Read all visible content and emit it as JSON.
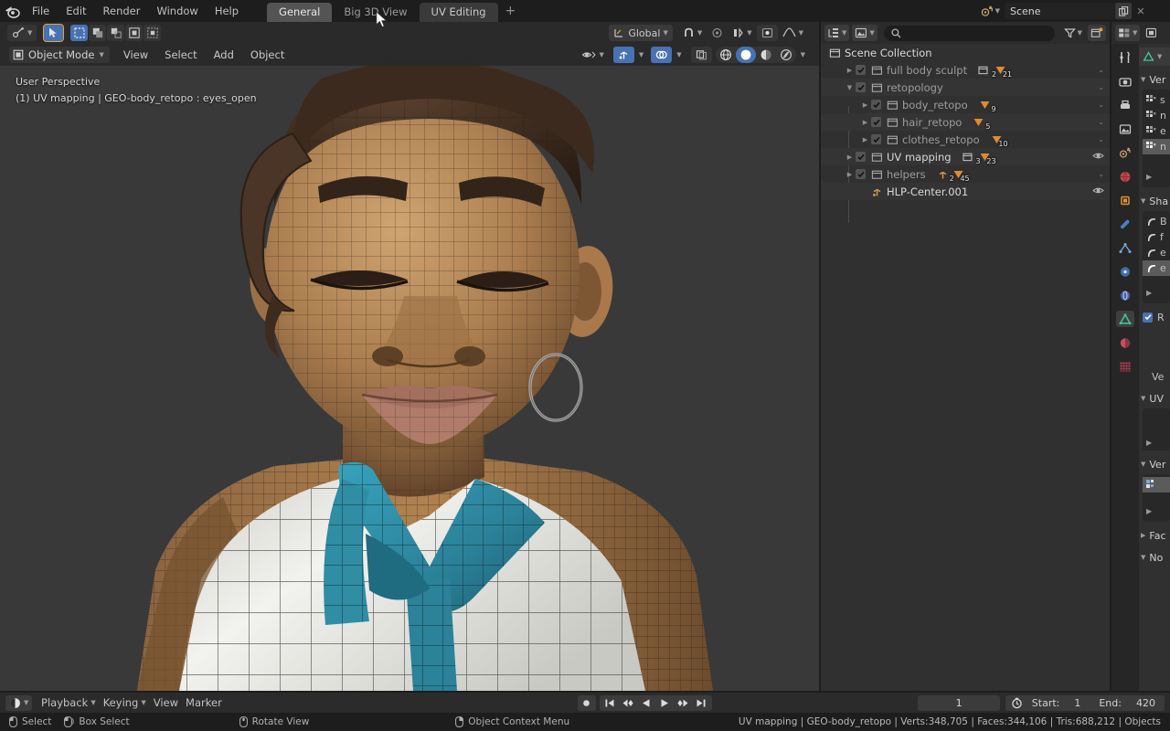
{
  "topbar": {
    "logo_icon": "blender-logo-icon",
    "menus": [
      "File",
      "Edit",
      "Render",
      "Window",
      "Help"
    ],
    "workspaces": [
      {
        "label": "General",
        "state": "active"
      },
      {
        "label": "Big 3D View",
        "state": "normal"
      },
      {
        "label": "UV Editing",
        "state": "hover"
      }
    ],
    "add_workspace_label": "+",
    "scene_icon": "scene-icon",
    "scene_name": "Scene",
    "new_scene_icon": "copy-icon",
    "remove_scene_icon": "close-icon"
  },
  "viewport": {
    "transform_pivot_icon": "transform-pivot-icon",
    "cursor_tool_icon": "cursor-tool-icon",
    "select_tools": [
      "select-box-icon",
      "select-circle-icon",
      "select-lasso-icon",
      "select-tweak-icon",
      "select-invert-icon"
    ],
    "orientation_label": "Global",
    "snap_icon": "magnet-icon",
    "proportional_icon": "proportional-edit-icon",
    "snap_target_icon": "snap-target-icon",
    "pivot_point_icon": "pivot-point-icon",
    "falloff_icon": "falloff-curve-icon",
    "mode_icon": "object-mode-icon",
    "mode_label": "Object Mode",
    "menus": [
      "View",
      "Select",
      "Add",
      "Object"
    ],
    "visibility_icon": "eye-visibility-icon",
    "gizmo_icon": "gizmo-icon",
    "overlays_icon": "overlays-icon",
    "xray_icon": "xray-toggle-icon",
    "shading_modes": [
      "wireframe-shading-icon",
      "solid-shading-icon",
      "material-preview-icon",
      "rendered-shading-icon"
    ],
    "shading_active_index": 1,
    "overlay_line_1": "User Perspective",
    "overlay_line_2": "(1) UV mapping | GEO-body_retopo : eyes_open",
    "background_color": "#393939"
  },
  "outliner": {
    "display_mode_icon": "outliner-display-mode-icon",
    "filter_id_icon": "outliner-id-type-icon",
    "search_icon": "search-icon",
    "search_value": "",
    "search_placeholder": "",
    "filter_icon": "filter-funnel-icon",
    "new_collection_icon": "new-collection-icon",
    "root": {
      "icon": "scene-collection-icon",
      "label": "Scene Collection"
    },
    "rows": [
      {
        "label": "full body sculpt",
        "indent": 1,
        "icon": "collection-icon",
        "checkbox": true,
        "disclosure": "collapsed",
        "dim": true,
        "badges": [
          {
            "icon": "collection-badge-icon",
            "count": "2"
          },
          {
            "icon": "mesh-badge-icon",
            "count": "21"
          }
        ],
        "right": "chevron",
        "stripe": false
      },
      {
        "label": "retopology",
        "indent": 1,
        "icon": "collection-icon",
        "checkbox": true,
        "disclosure": "expanded",
        "dim": true,
        "badges": [],
        "right": "chevron",
        "stripe": true
      },
      {
        "label": "body_retopo",
        "indent": 2,
        "icon": "collection-icon",
        "checkbox": true,
        "disclosure": "collapsed",
        "dim": true,
        "badges": [
          {
            "icon": "mesh-badge-icon",
            "count": "9"
          }
        ],
        "right": "chevron",
        "stripe": false
      },
      {
        "label": "hair_retopo",
        "indent": 2,
        "icon": "collection-icon",
        "checkbox": true,
        "disclosure": "collapsed",
        "dim": true,
        "badges": [
          {
            "icon": "mesh-badge-icon",
            "count": "5"
          }
        ],
        "right": "chevron",
        "stripe": true
      },
      {
        "label": "clothes_retopo",
        "indent": 2,
        "icon": "collection-icon",
        "checkbox": true,
        "disclosure": "collapsed",
        "dim": true,
        "badges": [
          {
            "icon": "mesh-badge-icon",
            "count": "10"
          }
        ],
        "right": "chevron",
        "stripe": false
      },
      {
        "label": "UV mapping",
        "indent": 1,
        "icon": "collection-icon",
        "checkbox": true,
        "disclosure": "collapsed",
        "dim": false,
        "badges": [
          {
            "icon": "collection-badge-icon",
            "count": "3"
          },
          {
            "icon": "mesh-badge-icon",
            "count": "23"
          }
        ],
        "right": "eye",
        "stripe": true
      },
      {
        "label": "helpers",
        "indent": 1,
        "icon": "collection-icon",
        "checkbox": true,
        "disclosure": "collapsed",
        "dim": true,
        "badges": [
          {
            "icon": "empty-badge-icon",
            "count": "2"
          },
          {
            "icon": "mesh-badge-icon",
            "count": "45"
          }
        ],
        "right": "chevron",
        "stripe": false
      },
      {
        "label": "HLP-Center.001",
        "indent": 1,
        "icon": "empty-axes-icon",
        "checkbox": false,
        "disclosure": "none",
        "dim": false,
        "badges": [],
        "right": "eye",
        "stripe": true
      }
    ]
  },
  "properties": {
    "editor_type_icon": "properties-editor-icon",
    "context_icon": "object-data-icon",
    "breadcrumb_icon": "mesh-data-icon",
    "tabs": [
      {
        "icon": "tool-tab-icon",
        "active": false
      },
      {
        "icon": "render-tab-icon",
        "active": false
      },
      {
        "icon": "output-tab-icon",
        "active": false
      },
      {
        "icon": "view-layer-tab-icon",
        "active": false
      },
      {
        "icon": "scene-tab-icon",
        "active": false
      },
      {
        "icon": "world-tab-icon",
        "active": false
      },
      {
        "icon": "object-tab-icon",
        "active": false
      },
      {
        "icon": "modifier-tab-icon",
        "active": false
      },
      {
        "icon": "particles-tab-icon",
        "active": false
      },
      {
        "icon": "physics-tab-icon",
        "active": false
      },
      {
        "icon": "constraints-tab-icon",
        "active": false
      },
      {
        "icon": "object-data-tab-icon",
        "active": true
      },
      {
        "icon": "material-tab-icon",
        "active": false
      },
      {
        "icon": "texture-tab-icon",
        "active": false
      }
    ],
    "panels": [
      {
        "title": "Ver",
        "items": [
          "s",
          "n",
          "e",
          "n"
        ],
        "item_icon": "vertex-group-icon",
        "selected_index": 3,
        "add_icon": "add-row-icon"
      },
      {
        "title": "Sha",
        "items": [
          "B",
          "f",
          "e",
          "e"
        ],
        "item_icon": "shapekey-icon",
        "selected_index": 3,
        "add_icon": "add-row-icon"
      }
    ],
    "relative_check_label": "R",
    "value_label": "Ve",
    "uv_panel_title": "UV",
    "vertex_colors_title": "Ver",
    "vc_item_icon": "vertex-color-icon",
    "faces_title": "Fac",
    "normals_title": "No",
    "accent_blue": "#4772b3"
  },
  "timeline": {
    "editor_icon": "timeline-editor-icon",
    "menus": [
      "Playback",
      "Keying",
      "View",
      "Marker"
    ],
    "record_icon": "auto-keying-icon",
    "transport": [
      "jump-to-start-icon",
      "jump-to-keyframe-prev-icon",
      "play-reverse-icon",
      "play-icon",
      "jump-to-keyframe-next-icon",
      "jump-to-end-icon"
    ],
    "current_frame": "1",
    "timer_icon": "use-preview-range-icon",
    "start_label": "Start:",
    "start_value": "1",
    "end_label": "End:",
    "end_value": "420"
  },
  "statusbar": {
    "keymap": [
      {
        "icon": "mouse-left-icon",
        "label": "Select"
      },
      {
        "icon": "mouse-left-drag-icon",
        "label": "Box Select"
      },
      {
        "icon": "mouse-middle-icon",
        "label": "Rotate View"
      },
      {
        "icon": "mouse-right-icon",
        "label": "Object Context Menu"
      }
    ],
    "stats": "UV mapping | GEO-body_retopo | Verts:348,705 | Faces:344,106 | Tris:688,212 | Objects"
  }
}
